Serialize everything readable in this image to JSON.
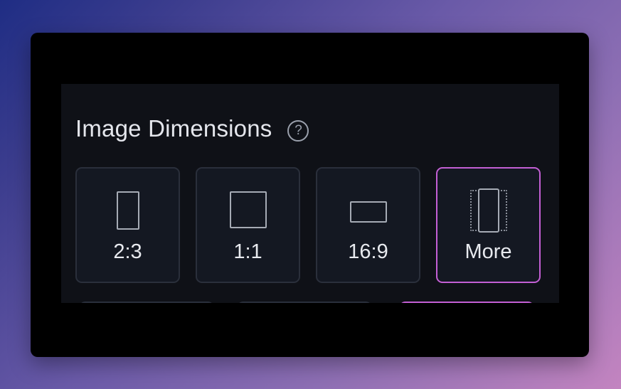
{
  "section": {
    "title": "Image Dimensions",
    "help_icon": "question-circle-icon",
    "help_glyph": "?"
  },
  "options": [
    {
      "label": "2:3",
      "icon": "portrait-aspect-icon",
      "selected": false
    },
    {
      "label": "1:1",
      "icon": "square-aspect-icon",
      "selected": false
    },
    {
      "label": "16:9",
      "icon": "landscape-aspect-icon",
      "selected": false
    },
    {
      "label": "More",
      "icon": "more-aspects-icon",
      "selected": true
    }
  ],
  "colors": {
    "accent": "#c35fd4",
    "card_bg": "#141822",
    "card_border": "#2a2f3b",
    "panel_bg": "#0f1117",
    "text": "#e8eaef"
  }
}
